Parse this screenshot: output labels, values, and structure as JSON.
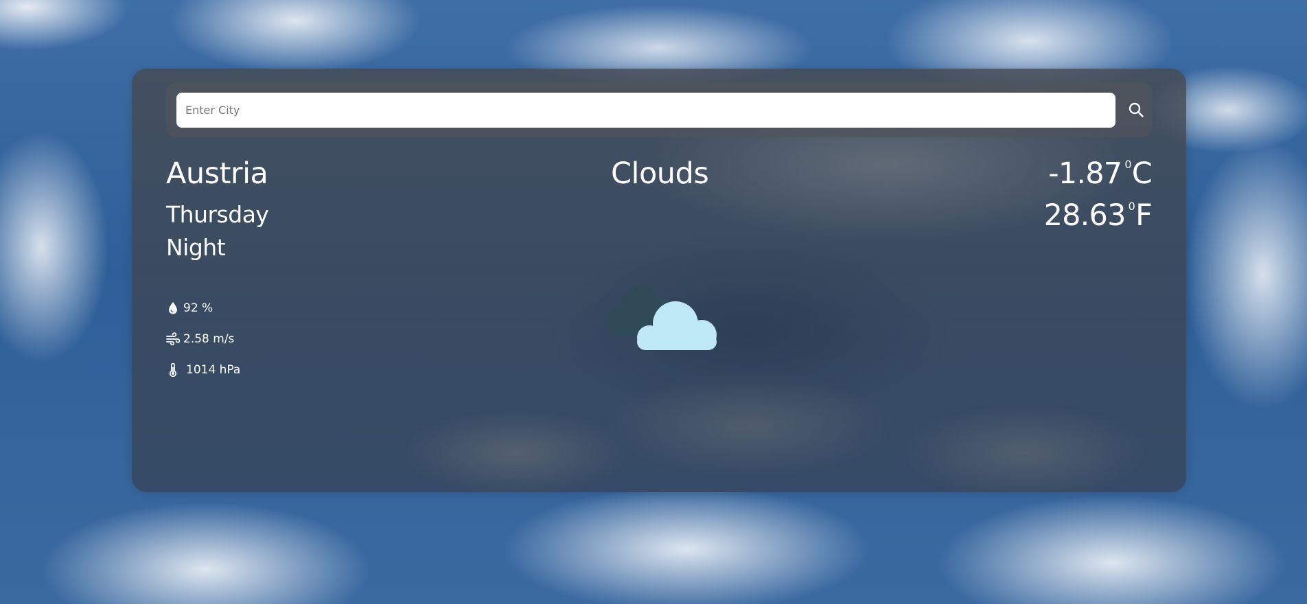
{
  "search": {
    "placeholder": "Enter City",
    "value": ""
  },
  "location": {
    "city": "Austria",
    "day": "Thursday",
    "period": "Night"
  },
  "weather": {
    "condition": "Clouds",
    "icon": "cloud-icon",
    "temp_c": "-1.87",
    "temp_f": "28.63",
    "deg_mark": "0",
    "unit_c": "C",
    "unit_f": "F"
  },
  "stats": {
    "humidity": "92 %",
    "wind": "2.58 m/s",
    "pressure": "1014 hPa"
  },
  "icons": {
    "search": "search-icon",
    "humidity": "water-drop-icon",
    "wind": "wind-icon",
    "pressure": "thermometer-icon"
  },
  "colors": {
    "cloud_front": "#bfe8f7",
    "cloud_back": "#2f4b56"
  }
}
